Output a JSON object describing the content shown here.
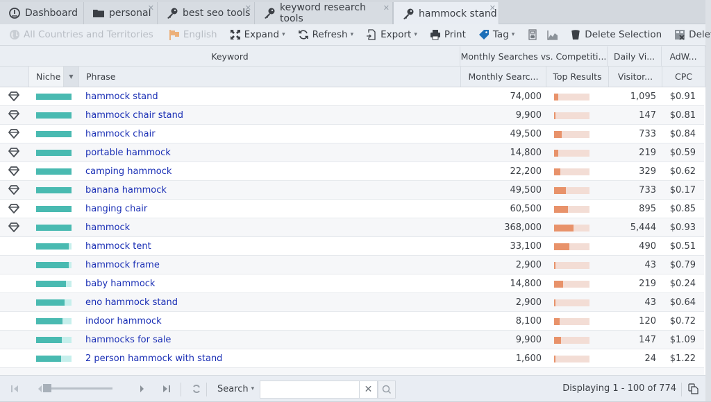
{
  "tabs": [
    {
      "label": "Dashboard",
      "icon": "dashboard-icon",
      "closable": false,
      "active": false
    },
    {
      "label": "personal",
      "icon": "folder-icon",
      "closable": true,
      "active": false
    },
    {
      "label": "best seo tools",
      "icon": "key-icon",
      "closable": true,
      "active": false
    },
    {
      "label": "keyword research tools",
      "icon": "key-icon",
      "closable": true,
      "active": false
    },
    {
      "label": "hammock stand",
      "icon": "key-icon",
      "closable": true,
      "active": true
    }
  ],
  "toolbar": {
    "country": "All Countries and Territories",
    "language": "English",
    "expand": "Expand",
    "refresh": "Refresh",
    "export": "Export",
    "print": "Print",
    "tag": "Tag",
    "delete_selection": "Delete Selection",
    "delete": "Delete"
  },
  "columns": {
    "group_keyword": "Keyword",
    "group_monthly": "Monthly Searches vs. Competiti...",
    "group_daily": "Daily Vi...",
    "group_adwords": "AdW...",
    "niche": "Niche",
    "phrase": "Phrase",
    "monthly_searches": "Monthly Searc...",
    "top_results": "Top Results",
    "visitors": "Visitor...",
    "cpc": "CPC"
  },
  "rows": [
    {
      "gem": true,
      "niche": 1.0,
      "phrase": "hammock stand",
      "searches": "74,000",
      "top": 0.12,
      "visitors": "1,095",
      "cpc": "$0.91"
    },
    {
      "gem": true,
      "niche": 1.0,
      "phrase": "hammock chair stand",
      "searches": "9,900",
      "top": 0.04,
      "visitors": "147",
      "cpc": "$0.81"
    },
    {
      "gem": true,
      "niche": 1.0,
      "phrase": "hammock chair",
      "searches": "49,500",
      "top": 0.22,
      "visitors": "733",
      "cpc": "$0.84"
    },
    {
      "gem": true,
      "niche": 1.0,
      "phrase": "portable hammock",
      "searches": "14,800",
      "top": 0.12,
      "visitors": "219",
      "cpc": "$0.59"
    },
    {
      "gem": true,
      "niche": 1.0,
      "phrase": "camping hammock",
      "searches": "22,200",
      "top": 0.18,
      "visitors": "329",
      "cpc": "$0.62"
    },
    {
      "gem": true,
      "niche": 1.0,
      "phrase": "banana hammock",
      "searches": "49,500",
      "top": 0.34,
      "visitors": "733",
      "cpc": "$0.17"
    },
    {
      "gem": true,
      "niche": 1.0,
      "phrase": "hanging chair",
      "searches": "60,500",
      "top": 0.4,
      "visitors": "895",
      "cpc": "$0.85"
    },
    {
      "gem": true,
      "niche": 1.0,
      "phrase": "hammock",
      "searches": "368,000",
      "top": 0.54,
      "visitors": "5,444",
      "cpc": "$0.93"
    },
    {
      "gem": false,
      "niche": 0.93,
      "phrase": "hammock tent",
      "searches": "33,100",
      "top": 0.44,
      "visitors": "490",
      "cpc": "$0.51"
    },
    {
      "gem": false,
      "niche": 0.93,
      "phrase": "hammock frame",
      "searches": "2,900",
      "top": 0.04,
      "visitors": "43",
      "cpc": "$0.79"
    },
    {
      "gem": false,
      "niche": 0.84,
      "phrase": "baby hammock",
      "searches": "14,800",
      "top": 0.26,
      "visitors": "219",
      "cpc": "$0.24"
    },
    {
      "gem": false,
      "niche": 0.8,
      "phrase": "eno hammock stand",
      "searches": "2,900",
      "top": 0.04,
      "visitors": "43",
      "cpc": "$0.64"
    },
    {
      "gem": false,
      "niche": 0.74,
      "phrase": "indoor hammock",
      "searches": "8,100",
      "top": 0.16,
      "visitors": "120",
      "cpc": "$0.72"
    },
    {
      "gem": false,
      "niche": 0.72,
      "phrase": "hammocks for sale",
      "searches": "9,900",
      "top": 0.2,
      "visitors": "147",
      "cpc": "$1.09"
    },
    {
      "gem": false,
      "niche": 0.7,
      "phrase": "2 person hammock with stand",
      "searches": "1,600",
      "top": 0.02,
      "visitors": "24",
      "cpc": "$1.22"
    }
  ],
  "footer": {
    "search_label": "Search",
    "search_value": "",
    "status": "Displaying 1 - 100 of 774"
  },
  "colors": {
    "niche_fill": "#49bab1",
    "niche_track": "#c6efec",
    "top_fill": "#e8926a",
    "top_track": "#f3ddd5",
    "link": "#1a2fb5"
  }
}
